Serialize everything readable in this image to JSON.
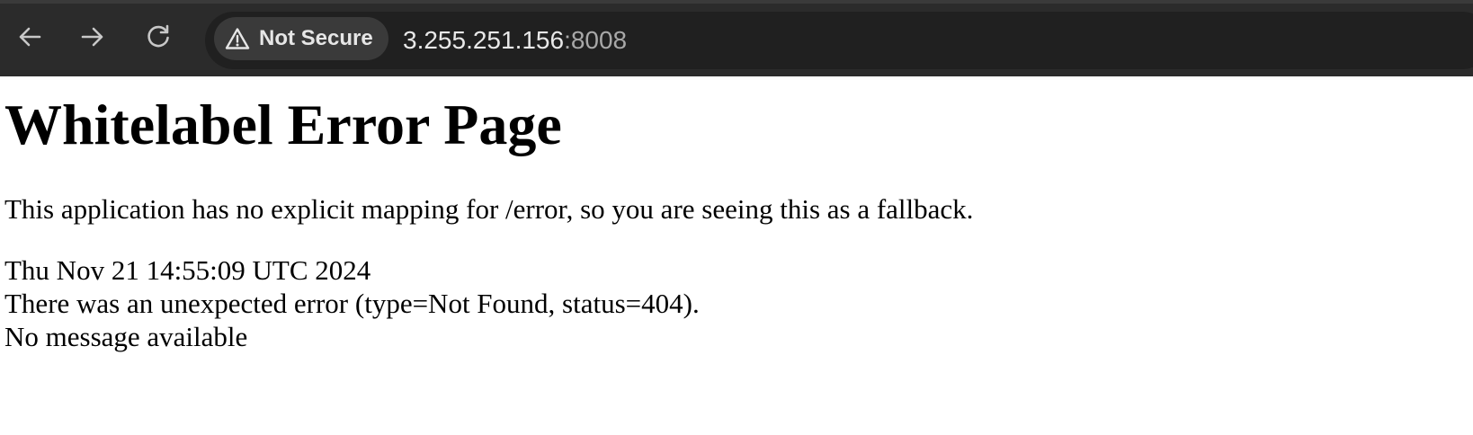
{
  "browser": {
    "security_label": "Not Secure",
    "url_host": "3.255.251.156",
    "url_port": ":8008",
    "icons": {
      "back": "arrow-left-icon",
      "forward": "arrow-right-icon",
      "reload": "reload-icon",
      "security": "warning-triangle-icon"
    }
  },
  "page": {
    "heading": "Whitelabel Error Page",
    "explanation": "This application has no explicit mapping for /error, so you are seeing this as a fallback.",
    "timestamp": "Thu Nov 21 14:55:09 UTC 2024",
    "error_line": "There was an unexpected error (type=Not Found, status=404).",
    "message": "No message available"
  },
  "colors": {
    "toolbar_bg": "#2b2b2b",
    "omnibox_bg": "#202020",
    "chip_bg": "#3a3a3a",
    "page_bg": "#ffffff"
  }
}
